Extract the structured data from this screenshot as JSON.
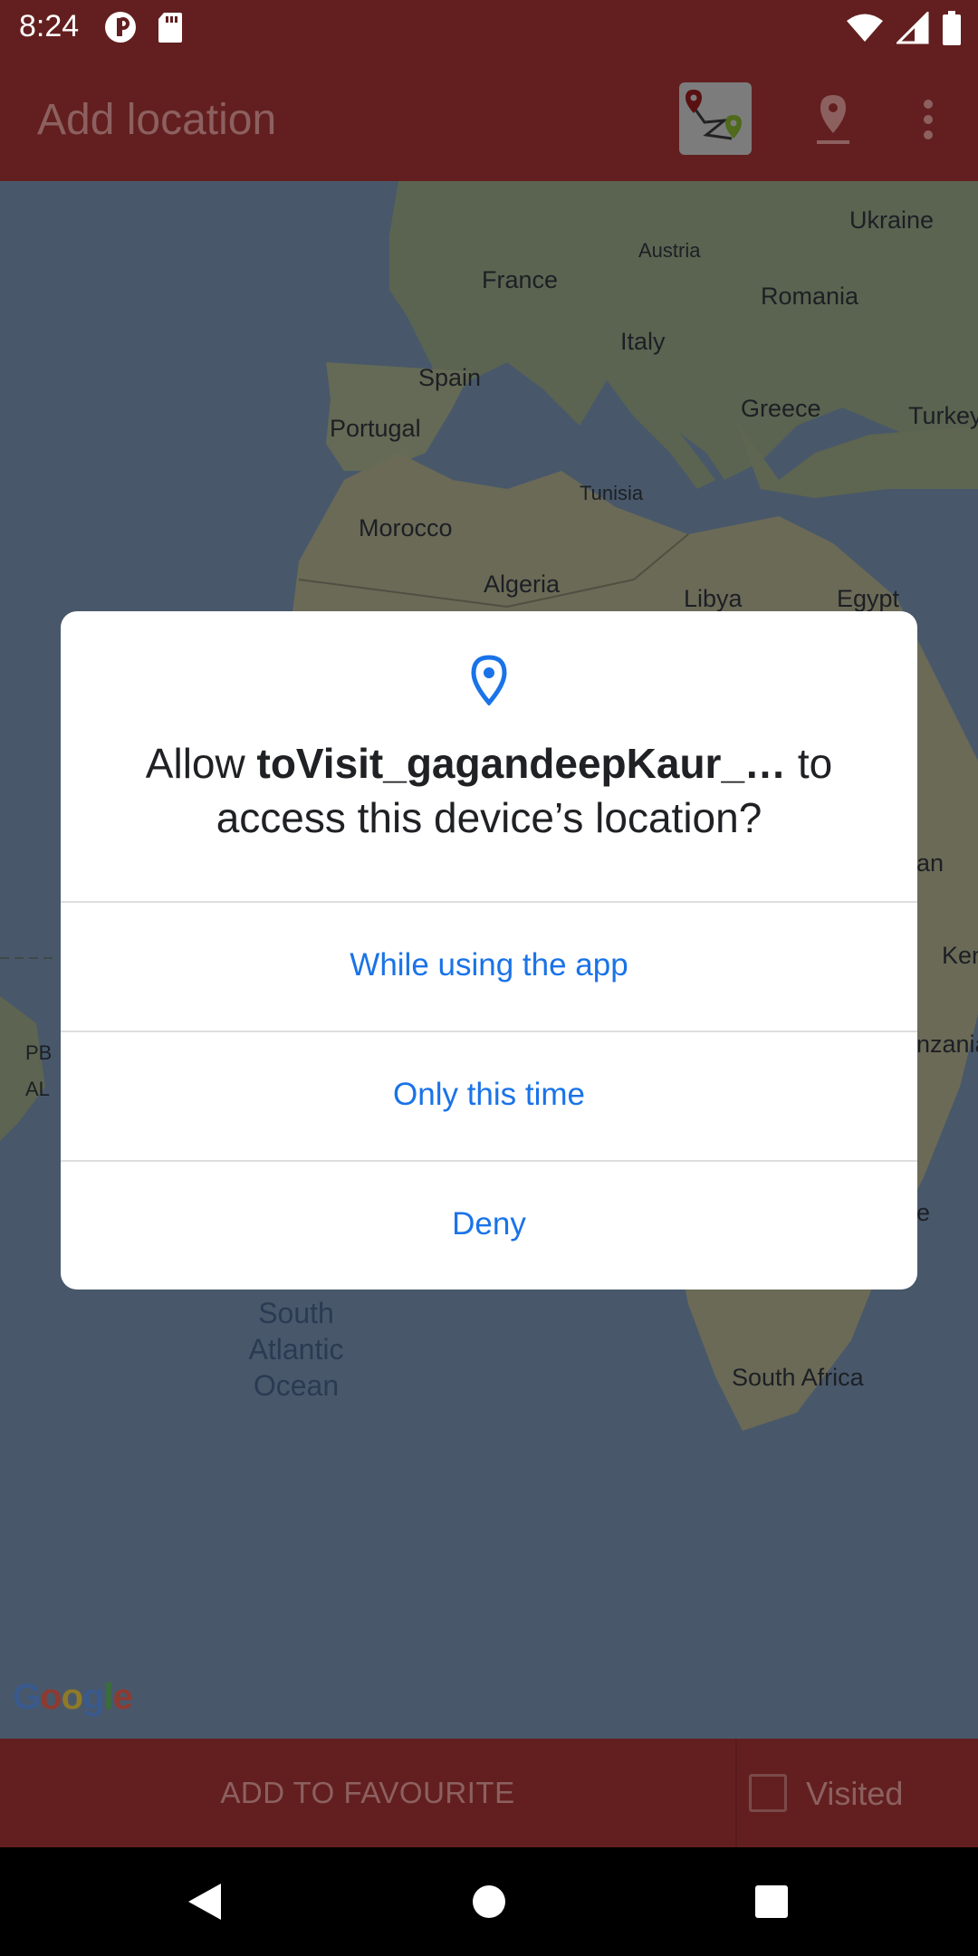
{
  "status_bar": {
    "time": "8:24"
  },
  "app_bar": {
    "title": "Add location",
    "icons": [
      "route-icon",
      "location-marker-icon",
      "overflow-menu-icon"
    ]
  },
  "map": {
    "labels": [
      "Ukraine",
      "Austria",
      "France",
      "Romania",
      "Italy",
      "Spain",
      "Greece",
      "Turkey",
      "Portugal",
      "Tunisia",
      "Morocco",
      "Algeria",
      "Libya",
      "Egypt",
      "an",
      "Ken",
      "PB",
      "AL",
      "nzania",
      "e",
      "South Africa"
    ],
    "ocean_label": [
      "South",
      "Atlantic",
      "Ocean"
    ],
    "logo": "Google"
  },
  "bottom_bar": {
    "favourite_label": "ADD TO FAVOURITE",
    "visited_label": "Visited",
    "visited_checked": false
  },
  "dialog": {
    "icon": "location-pin-icon",
    "title_prefix": "Allow ",
    "app_name": "toVisit_gagandeepKaur_…",
    "title_suffix_1": " to",
    "title_line_2": "access this device’s location?",
    "options": [
      "While using the app",
      "Only this time",
      "Deny"
    ],
    "accent_color": "#1a73e8"
  },
  "nav_bar": {
    "icons": [
      "back-icon",
      "home-icon",
      "recents-icon"
    ]
  }
}
